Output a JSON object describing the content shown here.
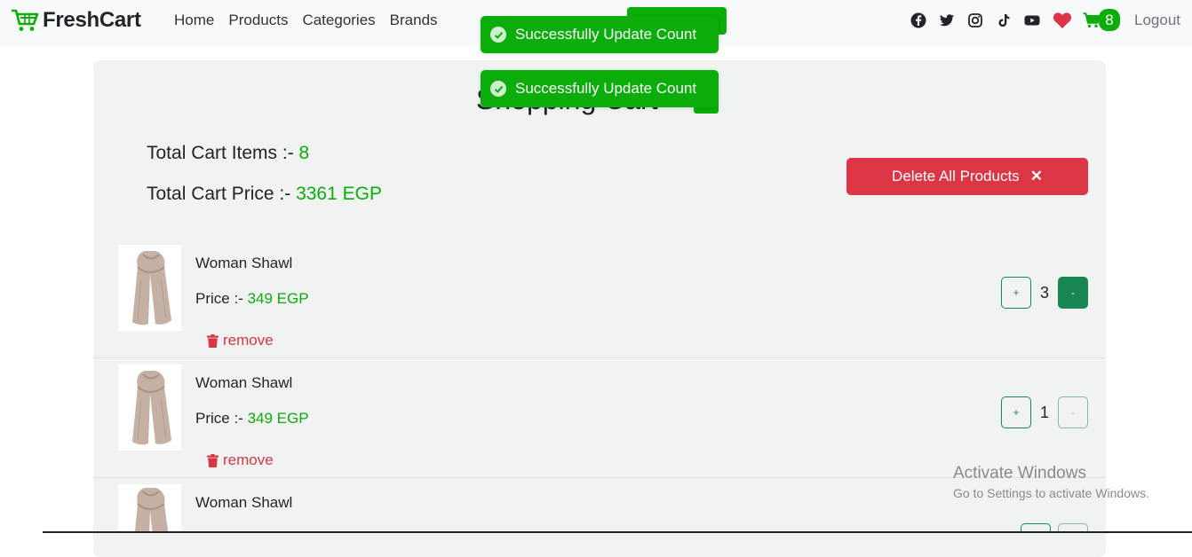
{
  "brand": {
    "name": "FreshCart",
    "icon": "cart-icon"
  },
  "nav": {
    "links": [
      "Home",
      "Products",
      "Categories",
      "Brands"
    ],
    "social_icons": [
      "facebook-icon",
      "twitter-icon",
      "instagram-icon",
      "tiktok-icon",
      "youtube-icon"
    ],
    "wishlist_icon": "heart-icon",
    "cart_count": "8",
    "logout": "Logout"
  },
  "toasts": [
    {
      "message": "Successfully Update Count"
    },
    {
      "message": "Successfully Update Count"
    }
  ],
  "cart": {
    "title": "Shopping Cart",
    "total_items_label": "Total Cart Items :-",
    "total_items_value": "8",
    "total_price_label": "Total Cart Price :-",
    "total_price_value": "3361 EGP",
    "delete_all_label": "Delete All Products",
    "delete_all_icon": "✕",
    "items": [
      {
        "name": "Woman Shawl",
        "price_label": "Price :-",
        "price_value": "349 EGP",
        "remove_label": "remove",
        "qty": "3",
        "plus": "+",
        "minus": "-"
      },
      {
        "name": "Woman Shawl",
        "price_label": "Price :-",
        "price_value": "349 EGP",
        "remove_label": "remove",
        "qty": "1",
        "plus": "+",
        "minus": "-"
      },
      {
        "name": "Woman Shawl"
      }
    ]
  },
  "watermark": {
    "line1": "Activate Windows",
    "line2": "Go to Settings to activate Windows."
  },
  "colors": {
    "brand_green": "#0aad0a",
    "dark_green": "#198754",
    "danger_red": "#dc3545",
    "card_bg": "#f0f3f2",
    "nav_bg": "#f8f9fa"
  }
}
